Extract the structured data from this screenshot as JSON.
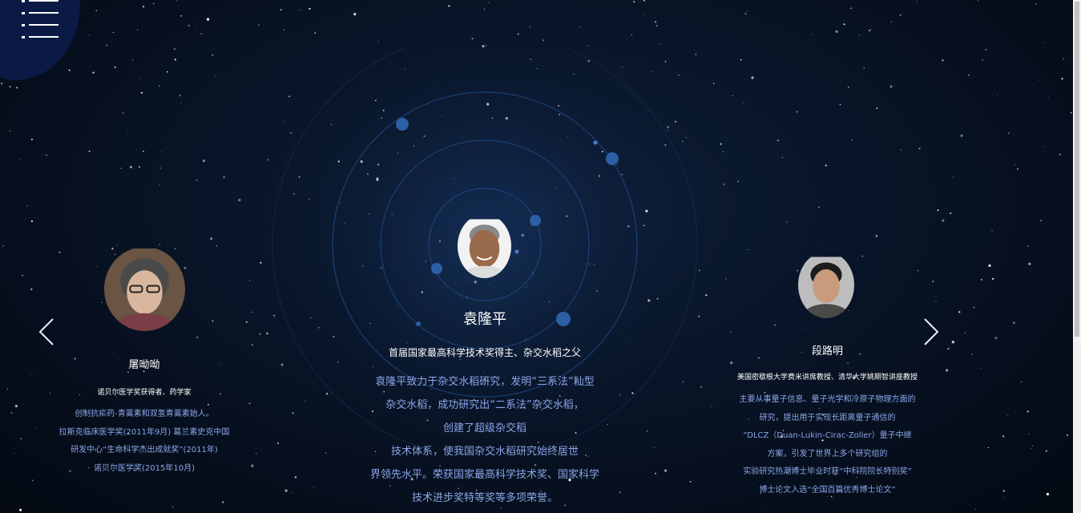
{
  "menu": {
    "icon": "hamburger-menu-icon"
  },
  "nav": {
    "prev_icon": "chevron-left-icon",
    "next_icon": "chevron-right-icon"
  },
  "people": {
    "left": {
      "name": "屠呦呦",
      "title": "诺贝尔医学奖获得者、药学家",
      "lines": [
        "创制抗疟药-青蒿素和双氢青蒿素始人。",
        "拉斯克临床医学奖(2011年9月) 葛兰素史克中国",
        "研发中心“生命科学杰出成就奖”(2011年)",
        "诺贝尔医学奖(2015年10月)"
      ]
    },
    "center": {
      "name": "袁隆平",
      "title": "首届国家最高科学技术奖得主、杂交水稻之父",
      "lines": [
        "袁隆平致力于杂交水稻研究，发明“三系法”籼型",
        "杂交水稻，成功研究出“二系法”杂交水稻，",
        "创建了超级杂交稻",
        "技术体系，使我国杂交水稻研究始终居世",
        "界领先水平。荣获国家最高科学技术奖、国家科学",
        "技术进步奖特等奖等多项荣誉。"
      ]
    },
    "right": {
      "name": "段路明",
      "title": "美国密歇根大学费米讲席教授、清华大学姚期智讲座教授",
      "lines": [
        "主要从事量子信息、量子光学和冷原子物理方面的",
        "研究，提出用于实现长距离量子通信的",
        "“DLCZ（Duan-Lukin-Cirac-Zoller）量子中继",
        "方案，引发了世界上多个研究组的",
        "实验研究热潮博士毕业时获“中科院院长特别奖”",
        "博士论文入选“全国百篇优秀博士论文”"
      ]
    }
  },
  "colors": {
    "accent_text": "#8ba6e8",
    "menu_bg": "#0a1a44",
    "orbit": "#1f4f8e"
  }
}
